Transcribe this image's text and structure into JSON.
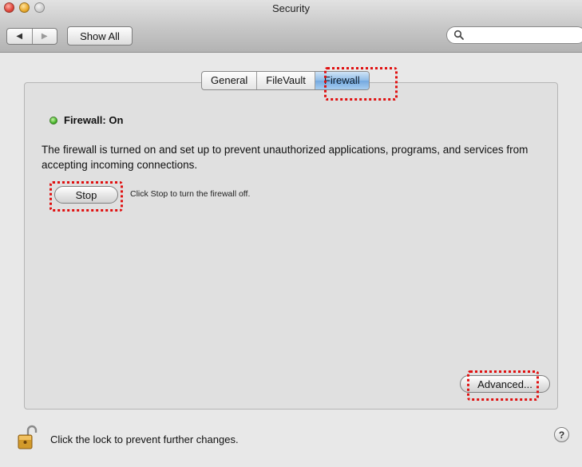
{
  "window": {
    "title": "Security"
  },
  "toolbar": {
    "back_icon": "back-arrow-icon",
    "forward_icon": "forward-arrow-icon",
    "show_all_label": "Show All",
    "search_placeholder": "",
    "search_icon": "magnifier-icon"
  },
  "tabs": [
    {
      "label": "General",
      "active": false
    },
    {
      "label": "FileVault",
      "active": false
    },
    {
      "label": "Firewall",
      "active": true
    }
  ],
  "firewall": {
    "status_label": "Firewall: On",
    "status_color": "#45b52a",
    "description": "The firewall is turned on and set up to prevent unauthorized applications, programs, and services from accepting incoming connections.",
    "stop_label": "Stop",
    "stop_hint": "Click Stop to turn the firewall off.",
    "advanced_label": "Advanced..."
  },
  "footer": {
    "lock_icon": "lock-open-icon",
    "lock_text": "Click the lock to prevent further changes.",
    "help_label": "?"
  },
  "colors": {
    "highlight": "#e01010",
    "active_tab": "#74a9df"
  }
}
